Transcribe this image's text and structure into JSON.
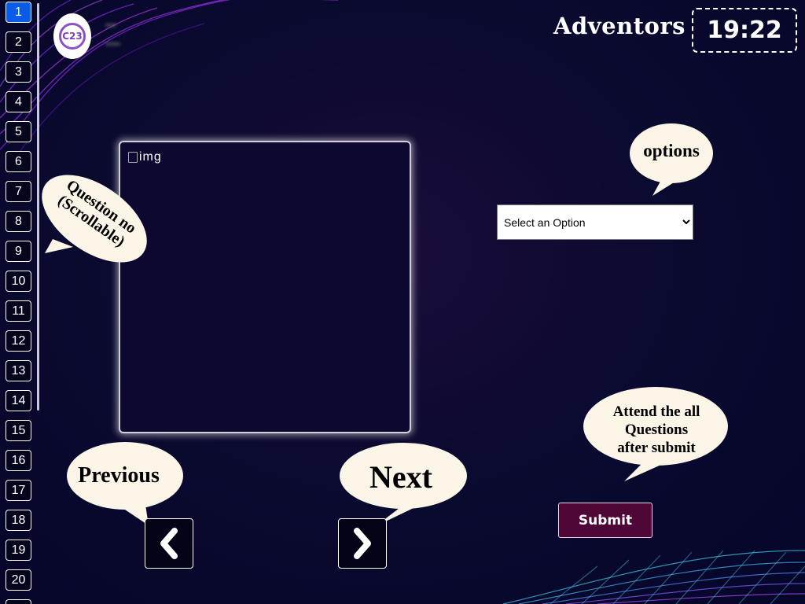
{
  "header": {
    "logo_text": "C23",
    "team_name": "▪▪▪",
    "team_id": "▪▪▪▪",
    "brand": "Adventors",
    "timer": "19:22"
  },
  "question_nav": {
    "active": 1,
    "numbers": [
      "1",
      "2",
      "3",
      "4",
      "5",
      "6",
      "7",
      "8",
      "9",
      "10",
      "11",
      "12",
      "13",
      "14",
      "15",
      "16",
      "17",
      "18",
      "19",
      "20"
    ]
  },
  "question": {
    "image_alt": "img"
  },
  "annotations": {
    "question_no_line1": "Question no",
    "question_no_line2": "(Scrollable)",
    "options": "options",
    "previous": "Previous",
    "next": "Next",
    "submit_hint_line1": "Attend the all",
    "submit_hint_line2": "Questions",
    "submit_hint_line3": "after submit"
  },
  "answer": {
    "placeholder": "Select an Option"
  },
  "controls": {
    "submit_label": "Submit"
  },
  "colors": {
    "active_question": "#0a5be8",
    "submit_bg": "#4e0736",
    "bubble_fill": "#fbf5e8",
    "background": "#05062a"
  }
}
